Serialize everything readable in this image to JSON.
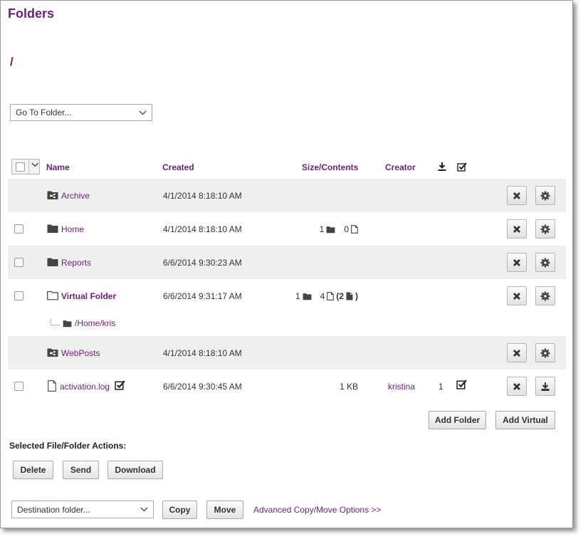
{
  "page": {
    "title": "Folders",
    "path": "/"
  },
  "goto": {
    "placeholder": "Go To Folder..."
  },
  "columns": {
    "name": "Name",
    "created": "Created",
    "size": "Size/Contents",
    "creator": "Creator"
  },
  "rows": [
    {
      "name": "Archive",
      "created": "4/1/2014 8:18:10 AM"
    },
    {
      "name": "Home",
      "created": "4/1/2014 8:18:10 AM",
      "folders": "1",
      "files": "0"
    },
    {
      "name": "Reports",
      "created": "6/6/2014 9:30:23 AM"
    },
    {
      "name": "Virtual Folder",
      "created": "6/6/2014 9:31:17 AM",
      "folders": "1",
      "files": "4",
      "open": "(2",
      "close": ")"
    },
    {
      "name": "WebPosts",
      "created": "4/1/2014 8:18:10 AM"
    },
    {
      "name": "activation.log",
      "created": "6/6/2014 9:30:45 AM",
      "size": "1 KB",
      "creator": "kristina",
      "downloads": "1"
    }
  ],
  "virtual_sub": {
    "path": "/Home/kris"
  },
  "buttons": {
    "add_folder": "Add Folder",
    "add_virtual": "Add Virtual",
    "delete": "Delete",
    "send": "Send",
    "download": "Download",
    "copy": "Copy",
    "move": "Move"
  },
  "actions_label": "Selected File/Folder Actions:",
  "destination": {
    "placeholder": "Destination folder..."
  },
  "advanced_link": "Advanced Copy/Move Options >>",
  "icons": {
    "folder": "folder-icon",
    "shared_folder": "shared-folder-icon",
    "virtual_folder": "folder-outline-icon",
    "file": "file-icon",
    "delete": "close-icon",
    "settings": "gear-icon",
    "download": "download-icon",
    "check": "checkbox-checked-icon"
  },
  "colors": {
    "accent": "#6d1f7a",
    "row_shade": "#efefef"
  }
}
